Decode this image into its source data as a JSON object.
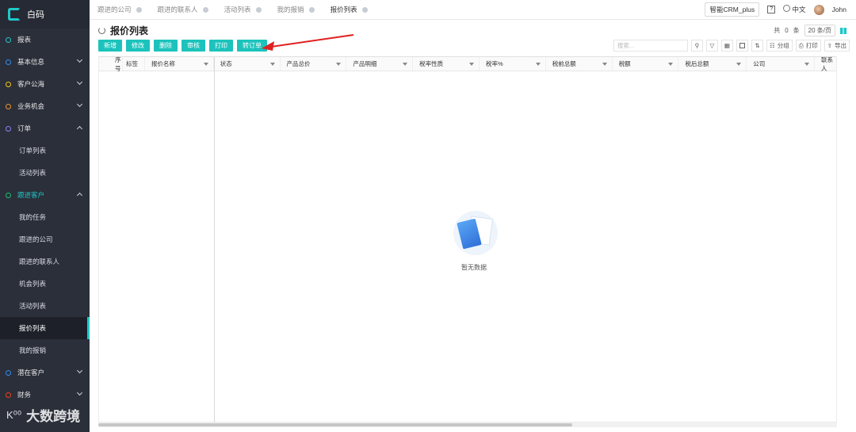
{
  "app": {
    "logo_text": "白码"
  },
  "sidebar": {
    "items": [
      {
        "label": "报表",
        "color": "#1fc8c8"
      },
      {
        "label": "基本信息",
        "color": "#2d8cf0"
      },
      {
        "label": "客户公海",
        "color": "#f5c518"
      },
      {
        "label": "业务机会",
        "color": "#f0932b"
      },
      {
        "label": "订单",
        "color": "#8e7ef0"
      }
    ],
    "order_sub": [
      "订单列表",
      "活动列表"
    ],
    "followup": {
      "label": "跟进客户",
      "color": "#19be6b"
    },
    "followup_sub": [
      "我的任务",
      "跟进的公司",
      "跟进的联系人",
      "机会列表",
      "活动列表",
      "报价列表",
      "我的报销"
    ],
    "bottom_items": [
      {
        "label": "潜在客户",
        "color": "#2d8cf0"
      },
      {
        "label": "财务",
        "color": "#ed4014"
      }
    ]
  },
  "topbar": {
    "tabs": [
      "跟进的公司",
      "跟进的联系人",
      "活动列表",
      "我的报销",
      "报价列表"
    ],
    "plan": "智能CRM_plus",
    "help": "?",
    "lang": "中文",
    "user": "John"
  },
  "page": {
    "title": "报价列表",
    "total_prefix": "共",
    "total_count": "0",
    "total_suffix": "条",
    "page_size": "20 条/页"
  },
  "actions": [
    "新增",
    "修改",
    "删除",
    "审核",
    "打印",
    "转订单"
  ],
  "tools": {
    "search_placeholder": "搜索...",
    "group": "分组",
    "print": "打印",
    "export": "导出"
  },
  "table": {
    "columns": [
      "序号",
      "标签",
      "报价名称",
      "状态",
      "产品总价",
      "产品明细",
      "税率性质",
      "税率%",
      "税前总额",
      "税额",
      "税后总额",
      "公司",
      "联系人"
    ]
  },
  "empty": {
    "text": "暂无数据"
  },
  "watermark": {
    "text": "大数跨境",
    "logo": "K⁰⁰"
  },
  "colors": {
    "accent": "#1cc3bc",
    "sidebar_bg": "#2b2f3a",
    "arrow": "#e02020"
  }
}
